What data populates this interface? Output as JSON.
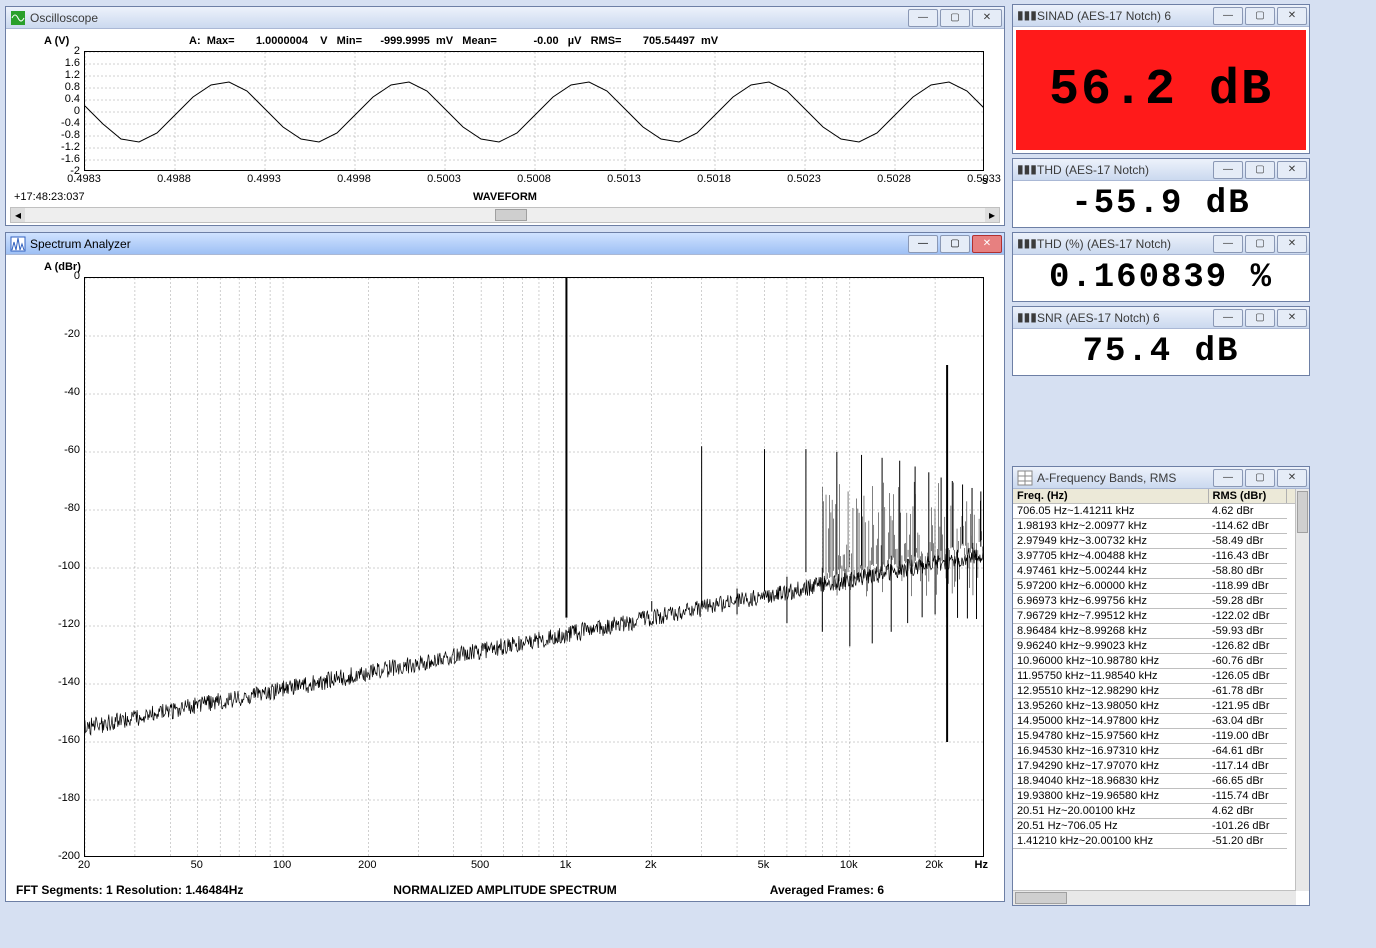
{
  "oscilloscope": {
    "title": "Oscilloscope",
    "header": "A:  Max=       1.0000004    V   Min=      -999.9995  mV   Mean=            -0.00   µV   RMS=       705.54497  mV",
    "y_label": "A  (V)",
    "x_unit": "s",
    "timestamp": "+17:48:23:037",
    "caption": "WAVEFORM",
    "y_ticks": [
      "2",
      "1.6",
      "1.2",
      "0.8",
      "0.4",
      "0",
      "-0.4",
      "-0.8",
      "-1.2",
      "-1.6",
      "-2"
    ],
    "x_ticks": [
      "0.4983",
      "0.4988",
      "0.4993",
      "0.4998",
      "0.5003",
      "0.5008",
      "0.5013",
      "0.5018",
      "0.5023",
      "0.5028",
      "0.5033"
    ]
  },
  "spectrum": {
    "title": "Spectrum Analyzer",
    "y_label": "A (dBr)",
    "x_unit": "Hz",
    "caption": "NORMALIZED AMPLITUDE SPECTRUM",
    "status_left": "FFT Segments: 1    Resolution: 1.46484Hz",
    "status_right": "Averaged Frames: 6",
    "y_ticks": [
      "0",
      "-20",
      "-40",
      "-60",
      "-80",
      "-100",
      "-120",
      "-140",
      "-160",
      "-180",
      "-200"
    ],
    "x_ticks": [
      "20",
      "50",
      "100",
      "200",
      "500",
      "1k",
      "2k",
      "5k",
      "10k",
      "20k"
    ]
  },
  "meters": {
    "sinad": {
      "title": "SINAD (AES-17 Notch)  6",
      "value": "56.2 dB",
      "bg": "#ff1a1a"
    },
    "thd_db": {
      "title": "THD (AES-17 Notch)",
      "value": "-55.9  dB"
    },
    "thd_pct": {
      "title": "THD (%) (AES-17 Notch)",
      "value": "0.160839  %"
    },
    "snr": {
      "title": "SNR (AES-17 Notch)  6",
      "value": "75.4  dB"
    }
  },
  "freq_table": {
    "title": "A-Frequency Bands, RMS",
    "col1": "Freq. (Hz)",
    "col2": "RMS (dBr)",
    "rows": [
      [
        "706.05 Hz~1.41211 kHz",
        "4.62 dBr"
      ],
      [
        "1.98193 kHz~2.00977 kHz",
        "-114.62 dBr"
      ],
      [
        "2.97949 kHz~3.00732 kHz",
        "-58.49 dBr"
      ],
      [
        "3.97705 kHz~4.00488 kHz",
        "-116.43 dBr"
      ],
      [
        "4.97461 kHz~5.00244 kHz",
        "-58.80 dBr"
      ],
      [
        "5.97200 kHz~6.00000 kHz",
        "-118.99 dBr"
      ],
      [
        "6.96973 kHz~6.99756 kHz",
        "-59.28 dBr"
      ],
      [
        "7.96729 kHz~7.99512 kHz",
        "-122.02 dBr"
      ],
      [
        "8.96484 kHz~8.99268 kHz",
        "-59.93 dBr"
      ],
      [
        "9.96240 kHz~9.99023 kHz",
        "-126.82 dBr"
      ],
      [
        "10.96000 kHz~10.98780 kHz",
        "-60.76 dBr"
      ],
      [
        "11.95750 kHz~11.98540 kHz",
        "-126.05 dBr"
      ],
      [
        "12.95510 kHz~12.98290 kHz",
        "-61.78 dBr"
      ],
      [
        "13.95260 kHz~13.98050 kHz",
        "-121.95 dBr"
      ],
      [
        "14.95000 kHz~14.97800 kHz",
        "-63.04 dBr"
      ],
      [
        "15.94780 kHz~15.97560 kHz",
        "-119.00 dBr"
      ],
      [
        "16.94530 kHz~16.97310 kHz",
        "-64.61 dBr"
      ],
      [
        "17.94290 kHz~17.97070 kHz",
        "-117.14 dBr"
      ],
      [
        "18.94040 kHz~18.96830 kHz",
        "-66.65 dBr"
      ],
      [
        "19.93800 kHz~19.96580 kHz",
        "-115.74 dBr"
      ],
      [
        "20.51 Hz~20.00100 kHz",
        "4.62 dBr"
      ],
      [
        "20.51 Hz~706.05 Hz",
        "-101.26 dBr"
      ],
      [
        "1.41210 kHz~20.00100 kHz",
        "-51.20 dBr"
      ]
    ]
  },
  "chart_data": [
    {
      "type": "line",
      "name": "oscilloscope-waveform",
      "xlabel": "s",
      "ylabel": "A (V)",
      "title": "WAVEFORM",
      "xlim": [
        0.4983,
        0.5033
      ],
      "ylim": [
        -2,
        2
      ],
      "note": "≈1 kHz sine, peak ≈ ±1 V, RMS ≈ 705.5 mV; ~5 cycles shown",
      "x": [
        0.4983,
        0.4984,
        0.4985,
        0.4986,
        0.4987,
        0.4988,
        0.4989,
        0.499,
        0.4991,
        0.4992,
        0.4993,
        0.4994,
        0.4995,
        0.4996,
        0.4997,
        0.4998,
        0.4999,
        0.5,
        0.5001,
        0.5002,
        0.5003,
        0.5004,
        0.5005,
        0.5006,
        0.5007,
        0.5008,
        0.5009,
        0.501,
        0.5011,
        0.5012,
        0.5013,
        0.5014,
        0.5015,
        0.5016,
        0.5017,
        0.5018,
        0.5019,
        0.502,
        0.5021,
        0.5022,
        0.5023,
        0.5024,
        0.5025,
        0.5026,
        0.5027,
        0.5028,
        0.5029,
        0.503,
        0.5031,
        0.5032,
        0.5033
      ],
      "values": [
        0.2,
        -0.4,
        -0.9,
        -1.0,
        -0.7,
        -0.1,
        0.5,
        0.9,
        1.0,
        0.7,
        0.1,
        -0.5,
        -0.9,
        -1.0,
        -0.7,
        -0.1,
        0.5,
        0.9,
        1.0,
        0.7,
        0.1,
        -0.5,
        -0.9,
        -1.0,
        -0.7,
        -0.1,
        0.5,
        0.9,
        1.0,
        0.7,
        0.1,
        -0.5,
        -0.9,
        -1.0,
        -0.7,
        -0.1,
        0.5,
        0.9,
        1.0,
        0.7,
        0.1,
        -0.5,
        -0.9,
        -1.0,
        -0.7,
        -0.1,
        0.5,
        0.9,
        1.0,
        0.7,
        0.1
      ]
    },
    {
      "type": "line",
      "name": "normalized-amplitude-spectrum",
      "xlabel": "Hz",
      "ylabel": "A (dBr)",
      "title": "NORMALIZED AMPLITUDE SPECTRUM",
      "xscale": "log",
      "xlim": [
        20,
        30000
      ],
      "ylim": [
        -200,
        0
      ],
      "peaks_hz_dbr": [
        [
          1000,
          0
        ],
        [
          2000,
          -115
        ],
        [
          3000,
          -58
        ],
        [
          4000,
          -116
        ],
        [
          5000,
          -59
        ],
        [
          6000,
          -119
        ],
        [
          7000,
          -59
        ],
        [
          8000,
          -122
        ],
        [
          9000,
          -60
        ],
        [
          10000,
          -127
        ],
        [
          11000,
          -61
        ],
        [
          12000,
          -126
        ],
        [
          13000,
          -62
        ],
        [
          14000,
          -122
        ],
        [
          15000,
          -63
        ],
        [
          16000,
          -119
        ],
        [
          17000,
          -65
        ],
        [
          18000,
          -117
        ],
        [
          19000,
          -67
        ],
        [
          20000,
          -116
        ],
        [
          22050,
          -30
        ]
      ],
      "noise_floor_approx_dbr": -155,
      "noise_floor_rises_to_at_20k": -95
    }
  ]
}
